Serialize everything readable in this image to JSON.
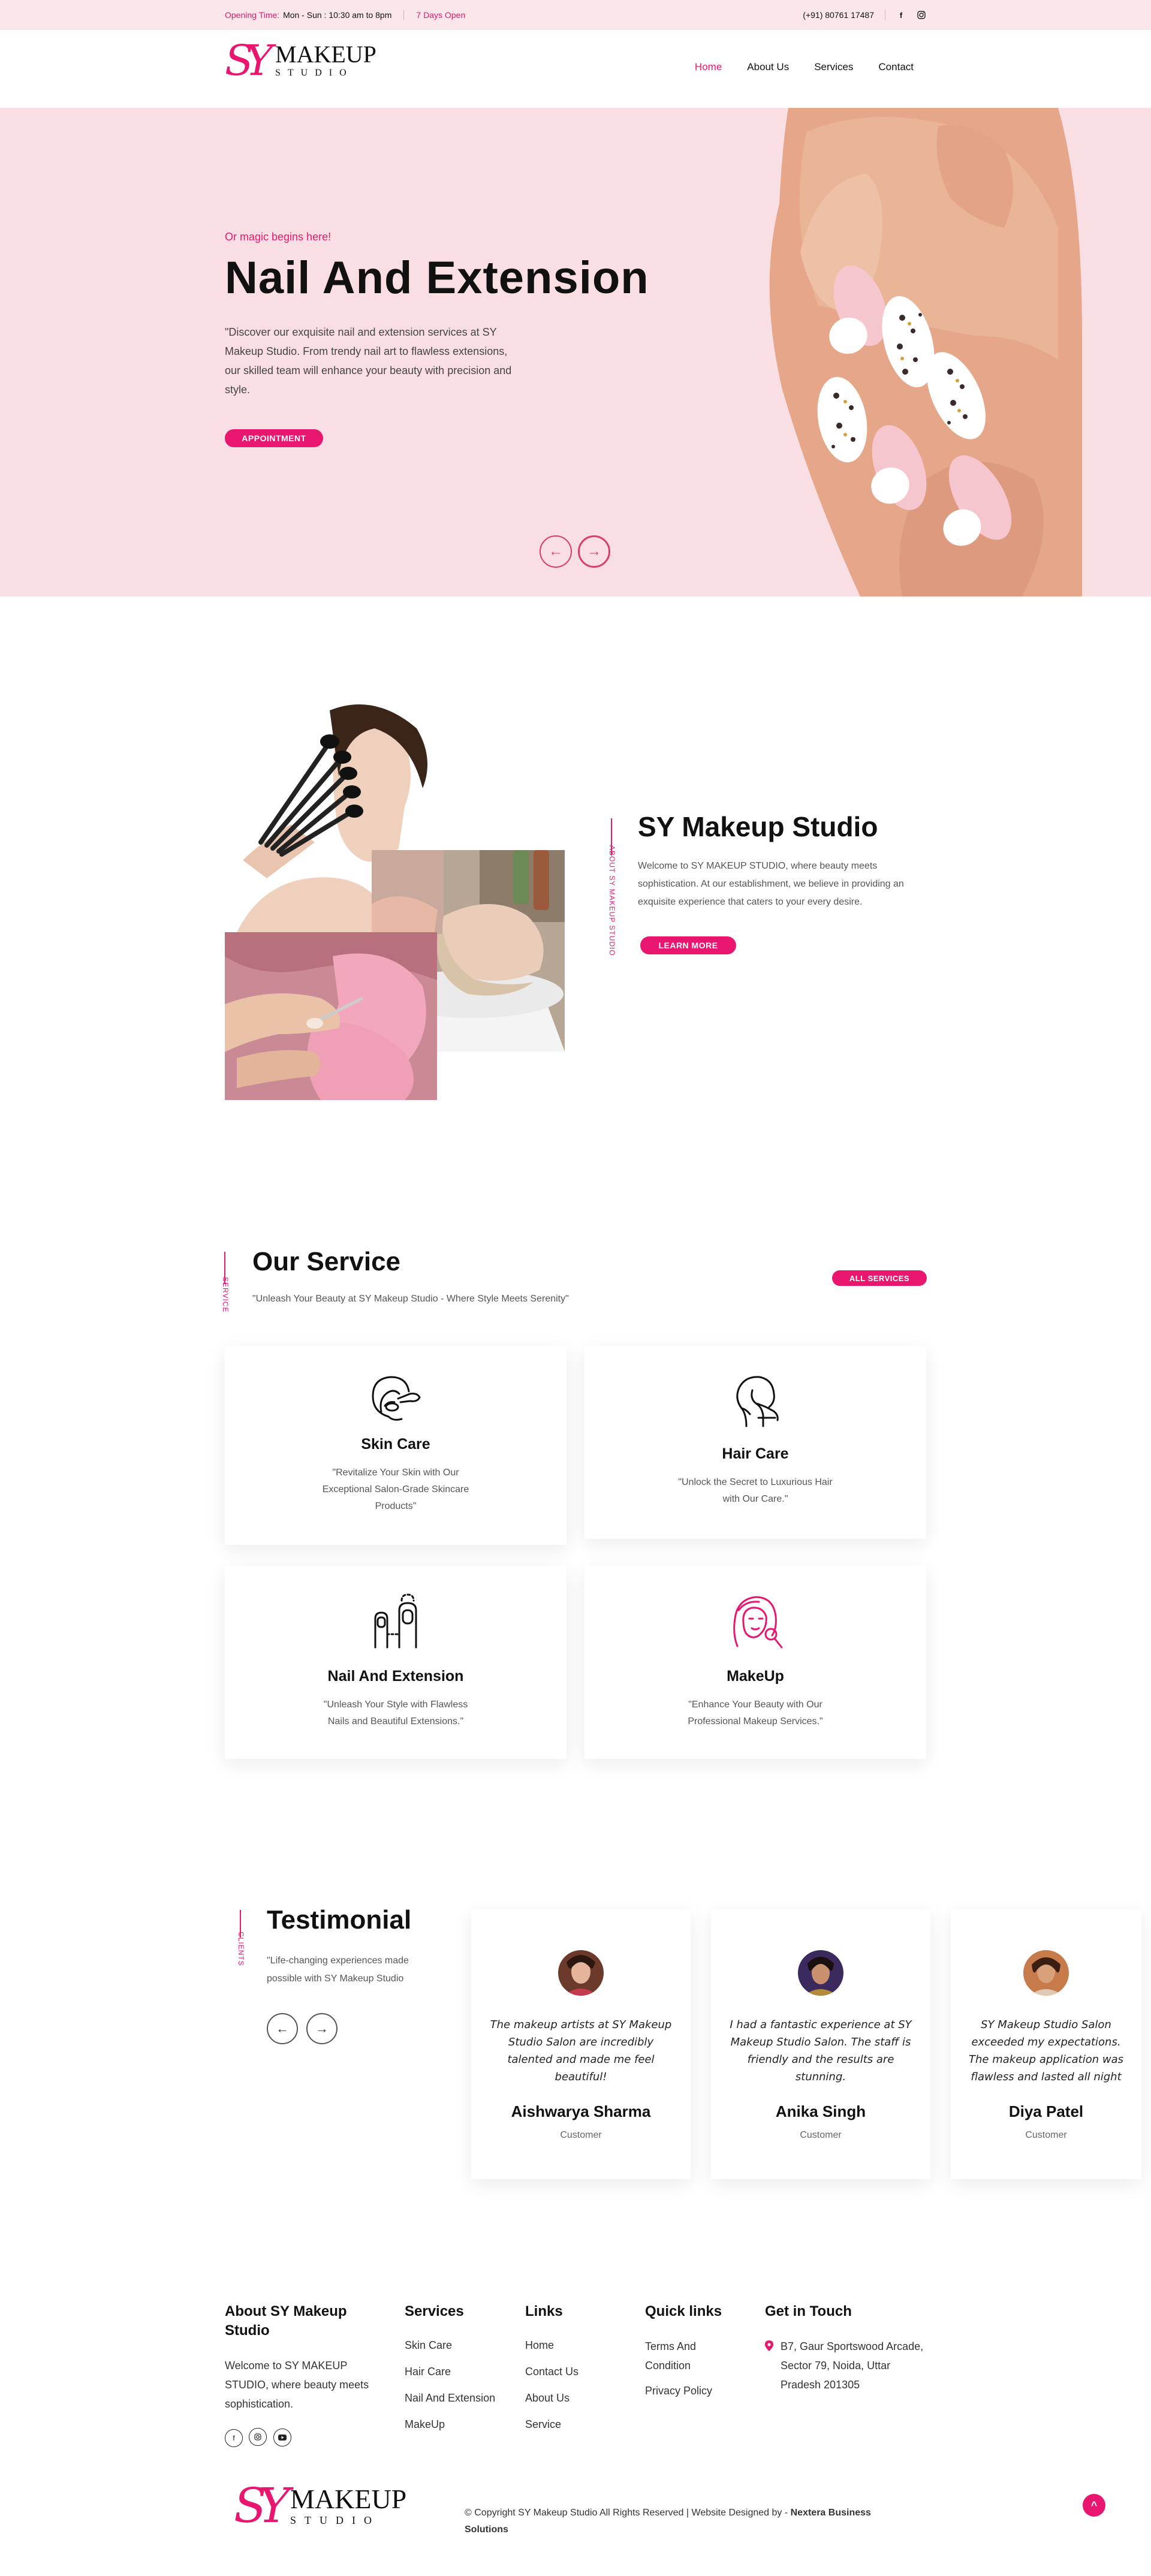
{
  "topbar": {
    "opening_label": "Opening Time:",
    "opening_hours": "Mon - Sun : 10:30 am to 8pm",
    "days_open": "7 Days Open",
    "phone": "(+91) 80761 17487",
    "icons": [
      "facebook-icon",
      "instagram-icon"
    ]
  },
  "logo": {
    "text": "MAKEUP",
    "subtext": "STUDIO",
    "monogram": "SY"
  },
  "nav": {
    "items": [
      "Home",
      "About Us",
      "Services",
      "Contact"
    ],
    "active": "Home"
  },
  "hero": {
    "tagline": "Or magic begins here!",
    "title": "Nail And Extension",
    "description": "\"Discover our exquisite nail and extension services at SY Makeup Studio. From trendy nail art to flawless extensions, our skilled team will enhance your beauty with precision and style.",
    "button": "APPOINTMENT",
    "prev_icon": "←",
    "next_icon": "→"
  },
  "about": {
    "vertical_label": "ABOUT SY MAKEUP STUDIO",
    "title": "SY Makeup Studio",
    "description": "Welcome to SY MAKEUP STUDIO, where beauty meets sophistication. At our establishment, we believe in providing an exquisite experience that caters to your every desire.",
    "button": "LEARN MORE"
  },
  "services": {
    "vertical_label": "SERVICE",
    "title": "Our Service",
    "subtitle": "\"Unleash Your Beauty at SY Makeup Studio - Where Style Meets Serenity\"",
    "all_button": "ALL SERVICES",
    "items": [
      {
        "title": "Skin Care",
        "desc": "\"Revitalize Your Skin with Our Exceptional Salon-Grade Skincare Products\"",
        "icon": "skin-care-icon"
      },
      {
        "title": "Hair Care",
        "desc": "\"Unlock the Secret to Luxurious Hair with Our Care.\"",
        "icon": "hair-care-icon"
      },
      {
        "title": "Nail And Extension",
        "desc": "\"Unleash Your Style with Flawless Nails and Beautiful Extensions.\"",
        "icon": "nail-icon"
      },
      {
        "title": "MakeUp",
        "desc": "\"Enhance Your Beauty with Our Professional Makeup Services.\"",
        "icon": "makeup-icon"
      }
    ]
  },
  "testimonial": {
    "vertical_label": "CLIENTS",
    "title": "Testimonial",
    "subtitle": "\"Life-changing experiences made possible with SY Makeup Studio",
    "prev_icon": "←",
    "next_icon": "→",
    "items": [
      {
        "quote": "The makeup artists at SY Makeup Studio Salon are incredibly talented and made me feel beautiful!",
        "name": "Aishwarya Sharma",
        "role": "Customer"
      },
      {
        "quote": "I had a fantastic experience at SY Makeup Studio Salon. The staff is friendly and the results are stunning.",
        "name": "Anika Singh",
        "role": "Customer"
      },
      {
        "quote": "SY Makeup Studio Salon exceeded my expectations. The makeup application was flawless and lasted all night",
        "name": "Diya Patel",
        "role": "Customer"
      }
    ]
  },
  "footer": {
    "about": {
      "title": "About SY Makeup Studio",
      "text": "Welcome to SY MAKEUP STUDIO, where beauty meets sophistication.",
      "socials": [
        "facebook-icon",
        "instagram-icon",
        "youtube-icon"
      ]
    },
    "services": {
      "title": "Services",
      "items": [
        "Skin Care",
        "Hair Care",
        "Nail And Extension",
        "MakeUp"
      ]
    },
    "links": {
      "title": "Links",
      "items": [
        "Home",
        "Contact Us",
        "About Us",
        "Service"
      ]
    },
    "quick": {
      "title": "Quick links",
      "items": [
        "Terms And Condition",
        "Privacy Policy"
      ]
    },
    "contact": {
      "title": "Get in Touch",
      "address": "B7, Gaur Sportswood Arcade, Sector 79, Noida, Uttar Pradesh 201305"
    },
    "copyright_prefix": "© Copyright SY Makeup Studio All Rights Reserved | Website Designed by - ",
    "designer": "Nextera Business Solutions",
    "top_icon": "^"
  },
  "colors": {
    "accent": "#e8166f",
    "hero_bg": "#f9dfe3",
    "topbar_bg": "#fbe6e9"
  }
}
